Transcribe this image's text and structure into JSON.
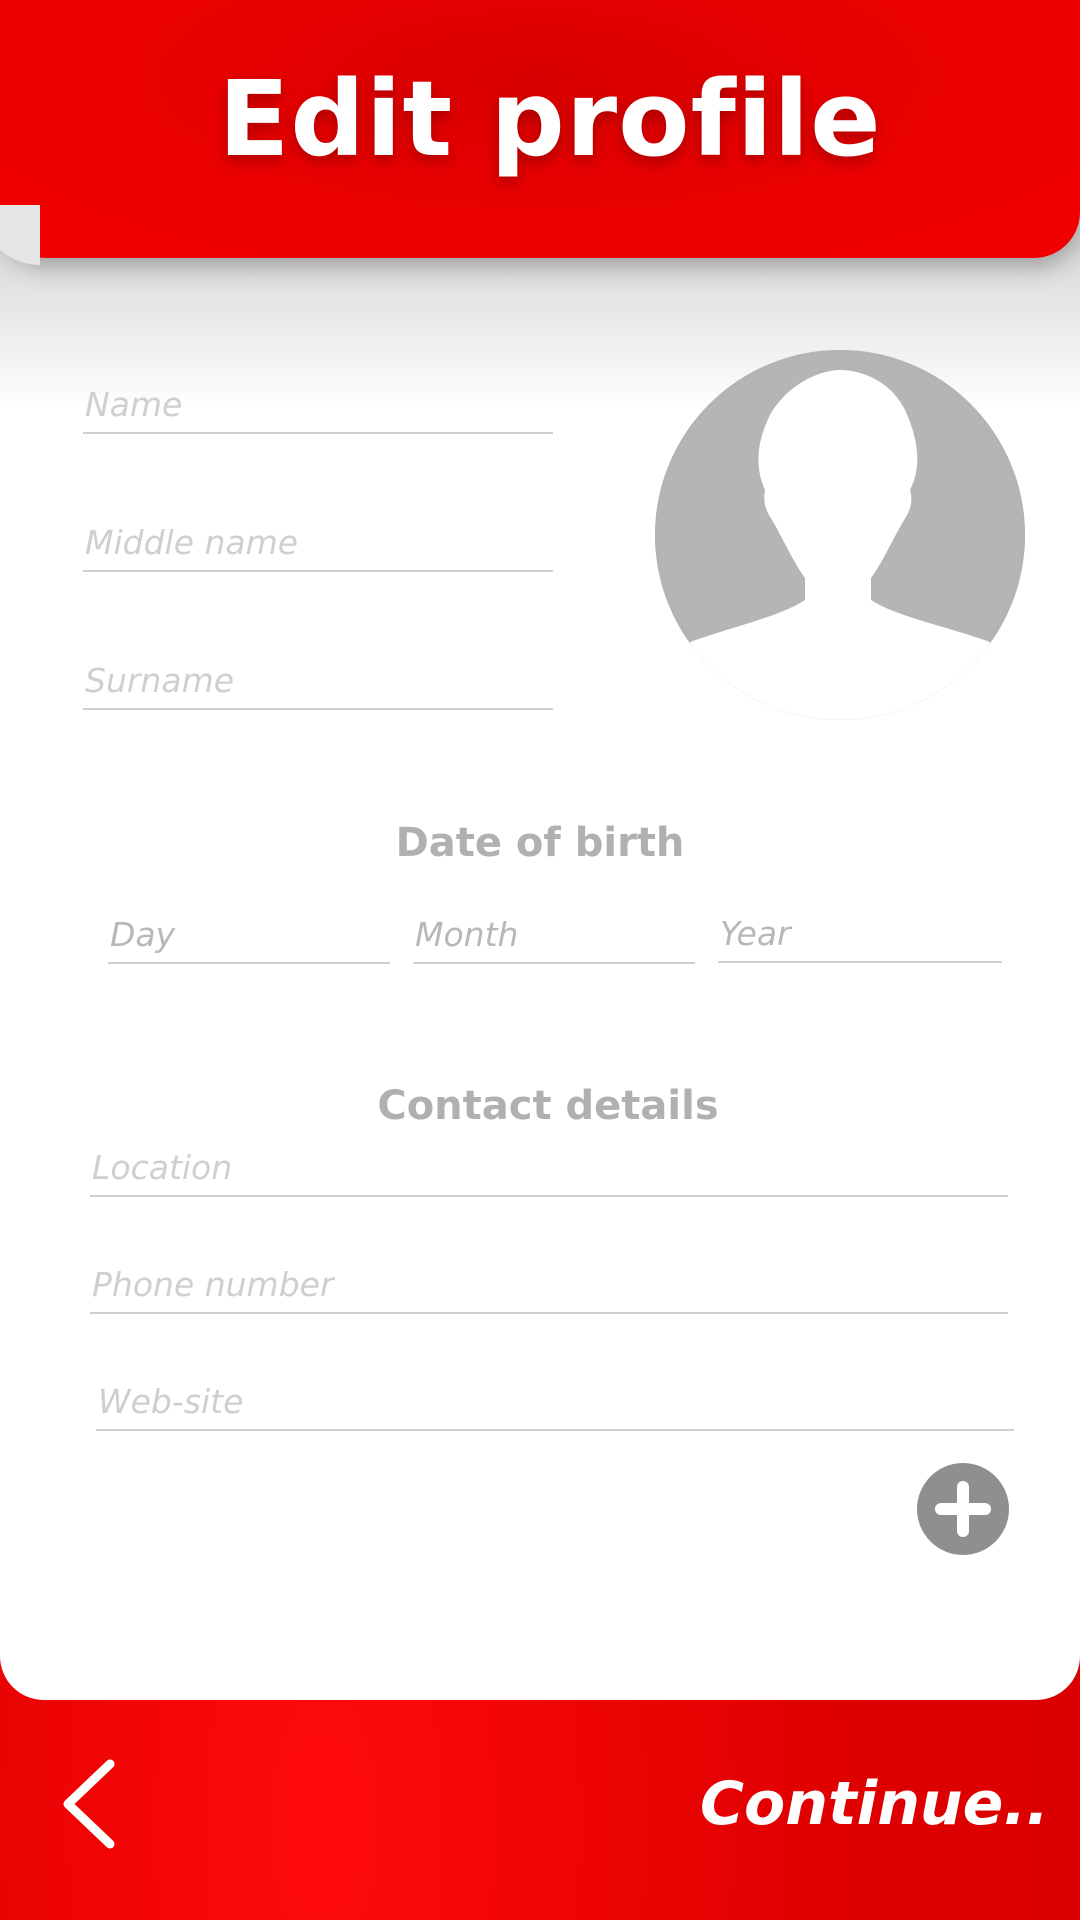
{
  "header": {
    "title": "Edit profile"
  },
  "form": {
    "name_placeholder": "Name",
    "middle_name_placeholder": "Middle name",
    "surname_placeholder": "Surname",
    "dob_label": "Date of birth",
    "day_placeholder": "Day",
    "month_placeholder": "Month",
    "year_placeholder": "Year",
    "contact_label": "Contact details",
    "location_placeholder": "Location",
    "phone_placeholder": "Phone number",
    "website_placeholder": "Web-site"
  },
  "footer": {
    "continue_label": "Continue.."
  },
  "colors": {
    "brand_red": "#e80000",
    "avatar_gray": "#b6b5b6",
    "button_gray": "#8f8f8f"
  },
  "icons": {
    "avatar": "person-silhouette-icon",
    "add": "plus-icon",
    "back": "chevron-left-icon"
  }
}
